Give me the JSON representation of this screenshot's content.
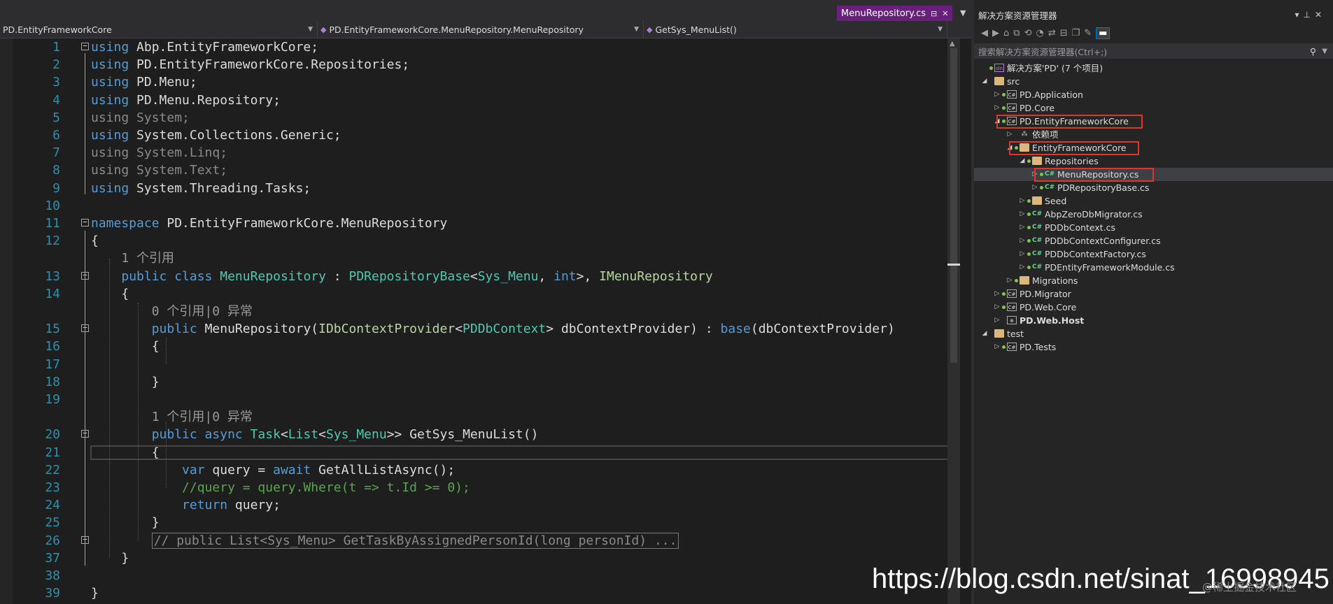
{
  "editor": {
    "active_tab": "MenuRepository.cs",
    "navbar": {
      "project": "PD.EntityFrameworkCore",
      "type": "PD.EntityFrameworkCore.MenuRepository.MenuRepository",
      "member": "GetSys_MenuList()"
    },
    "lines": [
      {
        "n": "1",
        "segs": [
          {
            "c": "kw",
            "t": "using"
          },
          {
            "t": " Abp.EntityFrameworkCore;"
          }
        ]
      },
      {
        "n": "2",
        "segs": [
          {
            "c": "kw",
            "t": "using"
          },
          {
            "t": " PD.EntityFrameworkCore.Repositories;"
          }
        ]
      },
      {
        "n": "3",
        "segs": [
          {
            "c": "kw",
            "t": "using"
          },
          {
            "t": " PD.Menu;"
          }
        ]
      },
      {
        "n": "4",
        "segs": [
          {
            "c": "kw",
            "t": "using"
          },
          {
            "t": " PD.Menu.Repository;"
          }
        ]
      },
      {
        "n": "5",
        "segs": [
          {
            "c": "dim",
            "t": "using System;"
          }
        ]
      },
      {
        "n": "6",
        "segs": [
          {
            "c": "kw",
            "t": "using"
          },
          {
            "t": " System.Collections.Generic;"
          }
        ]
      },
      {
        "n": "7",
        "segs": [
          {
            "c": "dim",
            "t": "using System.Linq;"
          }
        ]
      },
      {
        "n": "8",
        "segs": [
          {
            "c": "dim",
            "t": "using System.Text;"
          }
        ]
      },
      {
        "n": "9",
        "segs": [
          {
            "c": "kw",
            "t": "using"
          },
          {
            "t": " System.Threading.Tasks;"
          }
        ]
      },
      {
        "n": "10",
        "segs": []
      },
      {
        "n": "11",
        "segs": [
          {
            "c": "kw",
            "t": "namespace"
          },
          {
            "t": " PD.EntityFrameworkCore.MenuRepository"
          }
        ]
      },
      {
        "n": "12",
        "segs": [
          {
            "t": "{"
          }
        ]
      },
      {
        "n": "",
        "segs": [
          {
            "c": "lens",
            "t": "    1 个引用"
          }
        ]
      },
      {
        "n": "13",
        "segs": [
          {
            "t": "    "
          },
          {
            "c": "kw",
            "t": "public class"
          },
          {
            "t": " "
          },
          {
            "c": "ty",
            "t": "MenuRepository"
          },
          {
            "t": " : "
          },
          {
            "c": "ty",
            "t": "PDRepositoryBase"
          },
          {
            "t": "<"
          },
          {
            "c": "ty",
            "t": "Sys_Menu"
          },
          {
            "t": ", "
          },
          {
            "c": "kw",
            "t": "int"
          },
          {
            "t": ">, "
          },
          {
            "c": "gt",
            "t": "IMenuRepository"
          }
        ]
      },
      {
        "n": "14",
        "segs": [
          {
            "t": "    {"
          }
        ]
      },
      {
        "n": "",
        "segs": [
          {
            "c": "lens",
            "t": "        0 个引用|0 异常"
          }
        ]
      },
      {
        "n": "15",
        "segs": [
          {
            "t": "        "
          },
          {
            "c": "kw",
            "t": "public"
          },
          {
            "t": " MenuRepository("
          },
          {
            "c": "gt",
            "t": "IDbContextProvider"
          },
          {
            "t": "<"
          },
          {
            "c": "ty",
            "t": "PDDbContext"
          },
          {
            "t": "> dbContextProvider) : "
          },
          {
            "c": "kw",
            "t": "base"
          },
          {
            "t": "(dbContextProvider)"
          }
        ]
      },
      {
        "n": "16",
        "segs": [
          {
            "t": "        {"
          }
        ]
      },
      {
        "n": "17",
        "segs": []
      },
      {
        "n": "18",
        "segs": [
          {
            "t": "        }"
          }
        ]
      },
      {
        "n": "19",
        "segs": []
      },
      {
        "n": "",
        "segs": [
          {
            "c": "lens",
            "t": "        1 个引用|0 异常"
          }
        ]
      },
      {
        "n": "20",
        "segs": [
          {
            "t": "        "
          },
          {
            "c": "kw",
            "t": "public async"
          },
          {
            "t": " "
          },
          {
            "c": "ty",
            "t": "Task"
          },
          {
            "t": "<"
          },
          {
            "c": "ty",
            "t": "List"
          },
          {
            "t": "<"
          },
          {
            "c": "ty",
            "t": "Sys_Menu"
          },
          {
            "t": ">> GetSys_MenuList()"
          }
        ]
      },
      {
        "n": "21",
        "segs": [
          {
            "t": "        {"
          }
        ]
      },
      {
        "n": "22",
        "segs": [
          {
            "t": "            "
          },
          {
            "c": "kw",
            "t": "var"
          },
          {
            "t": " query = "
          },
          {
            "c": "kw",
            "t": "await"
          },
          {
            "t": " GetAllListAsync();"
          }
        ]
      },
      {
        "n": "23",
        "segs": [
          {
            "t": "            "
          },
          {
            "c": "cm",
            "t": "//query = query.Where(t => t.Id >= 0);"
          }
        ]
      },
      {
        "n": "24",
        "segs": [
          {
            "t": "            "
          },
          {
            "c": "kw",
            "t": "return"
          },
          {
            "t": " query;"
          }
        ]
      },
      {
        "n": "25",
        "segs": [
          {
            "t": "        }"
          }
        ]
      },
      {
        "n": "26",
        "segs": [
          {
            "t": "        "
          },
          {
            "c": "collapsed",
            "t": "// public List<Sys_Menu> GetTaskByAssignedPersonId(long personId) ..."
          }
        ]
      },
      {
        "n": "37",
        "segs": [
          {
            "t": "    }"
          }
        ]
      },
      {
        "n": "38",
        "segs": []
      },
      {
        "n": "39",
        "segs": [
          {
            "t": "}"
          }
        ]
      }
    ]
  },
  "solution_explorer": {
    "title": "解决方案资源管理器",
    "search_placeholder": "搜索解决方案资源管理器(Ctrl+;)",
    "nodes": [
      {
        "label": "解决方案'PD' (7 个项目)",
        "depth": 0,
        "icon": "solution",
        "expander": "",
        "dot": true
      },
      {
        "label": "src",
        "depth": 0,
        "icon": "folder",
        "expander": "◢",
        "dot": false
      },
      {
        "label": "PD.Application",
        "depth": 1,
        "icon": "project",
        "expander": "▷",
        "dot": true
      },
      {
        "label": "PD.Core",
        "depth": 1,
        "icon": "project",
        "expander": "▷",
        "dot": true
      },
      {
        "label": "PD.EntityFrameworkCore",
        "depth": 1,
        "icon": "project",
        "expander": "◢",
        "dot": true,
        "boxed": true
      },
      {
        "label": "依赖项",
        "depth": 2,
        "icon": "dependencies",
        "expander": "▷",
        "dot": false
      },
      {
        "label": "EntityFrameworkCore",
        "depth": 2,
        "icon": "folder",
        "expander": "◢",
        "dot": true,
        "boxed": true
      },
      {
        "label": "Repositories",
        "depth": 3,
        "icon": "folder",
        "expander": "◢",
        "dot": true
      },
      {
        "label": "MenuRepository.cs",
        "depth": 4,
        "icon": "cs",
        "expander": "▷",
        "dot": true,
        "boxed": true,
        "selected": true
      },
      {
        "label": "PDRepositoryBase.cs",
        "depth": 4,
        "icon": "cs",
        "expander": "▷",
        "dot": true
      },
      {
        "label": "Seed",
        "depth": 3,
        "icon": "folder",
        "expander": "▷",
        "dot": true
      },
      {
        "label": "AbpZeroDbMigrator.cs",
        "depth": 3,
        "icon": "cs",
        "expander": "▷",
        "dot": true
      },
      {
        "label": "PDDbContext.cs",
        "depth": 3,
        "icon": "cs",
        "expander": "▷",
        "dot": true
      },
      {
        "label": "PDDbContextConfigurer.cs",
        "depth": 3,
        "icon": "cs",
        "expander": "▷",
        "dot": true
      },
      {
        "label": "PDDbContextFactory.cs",
        "depth": 3,
        "icon": "cs",
        "expander": "▷",
        "dot": true
      },
      {
        "label": "PDEntityFrameworkModule.cs",
        "depth": 3,
        "icon": "cs",
        "expander": "▷",
        "dot": true
      },
      {
        "label": "Migrations",
        "depth": 2,
        "icon": "folder",
        "expander": "▷",
        "dot": true
      },
      {
        "label": "PD.Migrator",
        "depth": 1,
        "icon": "project",
        "expander": "▷",
        "dot": true
      },
      {
        "label": "PD.Web.Core",
        "depth": 1,
        "icon": "project",
        "expander": "▷",
        "dot": true
      },
      {
        "label": "PD.Web.Host",
        "depth": 1,
        "icon": "webproject",
        "expander": "▷",
        "dot": false,
        "bold": true
      },
      {
        "label": "test",
        "depth": 0,
        "icon": "folder",
        "expander": "◢",
        "dot": false
      },
      {
        "label": "PD.Tests",
        "depth": 1,
        "icon": "project",
        "expander": "▷",
        "dot": true
      }
    ]
  },
  "watermark": {
    "url": "https://blog.csdn.net/sinat_16998945",
    "secondary": "@稀土掘金技术社区"
  }
}
